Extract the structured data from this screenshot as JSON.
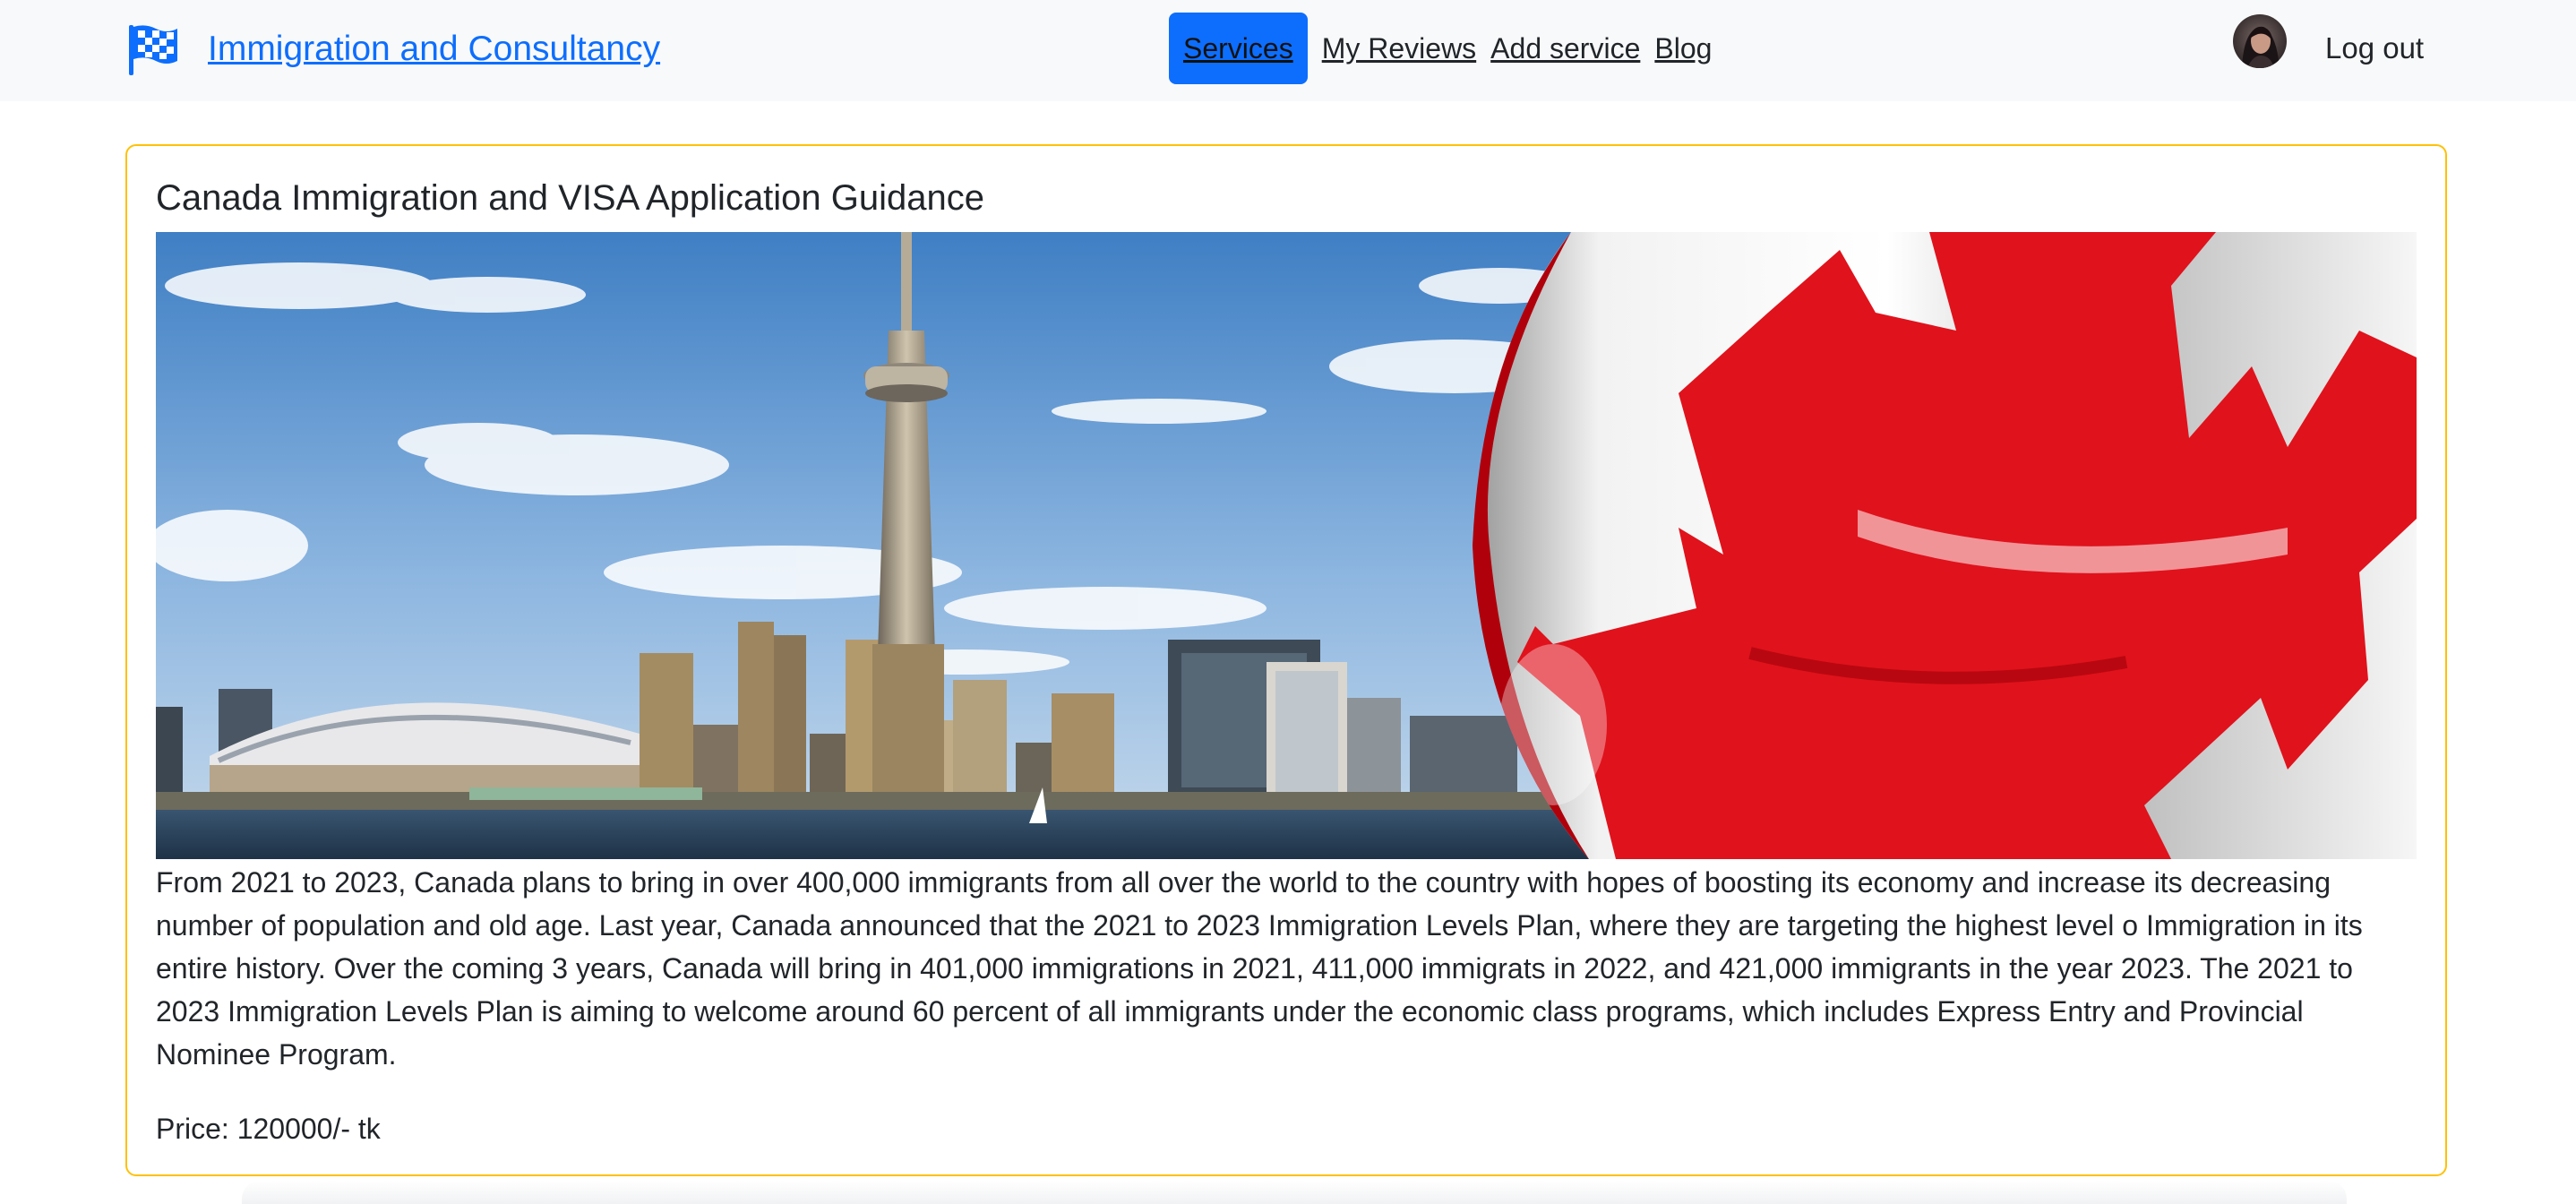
{
  "navbar": {
    "brand": "Immigration and Consultancy",
    "links": [
      {
        "label": "Services",
        "active": true
      },
      {
        "label": "My Reviews",
        "active": false
      },
      {
        "label": "Add service",
        "active": false
      },
      {
        "label": "Blog",
        "active": false
      }
    ],
    "logout_label": "Log out",
    "colors": {
      "accent": "#0d6efd",
      "background": "#f8f9fa"
    }
  },
  "service": {
    "title": "Canada Immigration and VISA Application Guidance",
    "description": "From 2021 to 2023, Canada plans to bring in over 400,000 immigrants from all over the world to the country with hopes of boosting its economy and increase its decreasing number of population and old age. Last year, Canada announced that the 2021 to 2023 Immigration Levels Plan, where they are targeting the highest level o Immigration in its entire history. Over the coming 3 years, Canada will bring in 401,000 immigrations in 2021, 411,000 immigrats in 2022, and 421,000 immigrants in the year 2023. The 2021 to 2023 Immigration Levels Plan is aiming to welcome around 60 percent of all immigrants under the economic class programs, which includes Express Entry and Provincial Nominee Program.",
    "price": "Price: 120000/- tk",
    "border_color": "#ffc107"
  },
  "icons": {
    "brand_logo": "checkered-flag-icon",
    "avatar": "user-avatar"
  }
}
